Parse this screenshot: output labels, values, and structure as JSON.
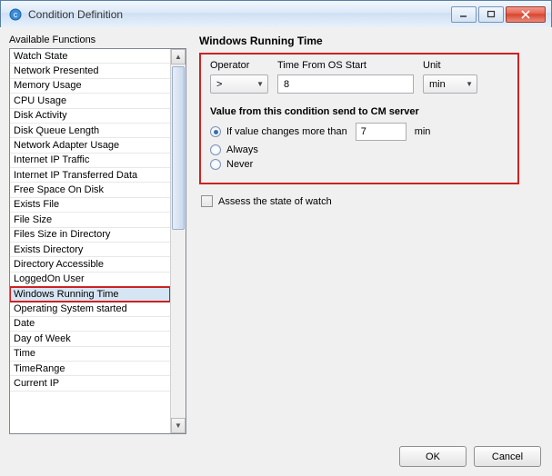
{
  "window": {
    "title": "Condition Definition"
  },
  "left": {
    "header": "Available Functions",
    "items": [
      "Watch State",
      "Network Presented",
      "Memory Usage",
      "CPU Usage",
      "Disk Activity",
      "Disk Queue Length",
      "Network Adapter Usage",
      "Internet IP Traffic",
      "Internet IP Transferred Data",
      "Free Space On Disk",
      "Exists File",
      "File Size",
      "Files Size in Directory",
      "Exists Directory",
      "Directory Accessible",
      "LoggedOn User",
      "Windows Running Time",
      "Operating System started",
      "Date",
      "Day of Week",
      "Time",
      "TimeRange",
      "Current IP"
    ],
    "selected_index": 16
  },
  "right": {
    "title": "Windows Running Time",
    "operator_label": "Operator",
    "operator_value": ">",
    "time_label": "Time From OS Start",
    "time_value": "8",
    "unit_label": "Unit",
    "unit_value": "min",
    "send_title": "Value from this condition send to CM server",
    "opt_changes_label": "If value changes more than",
    "opt_changes_value": "7",
    "opt_changes_unit": "min",
    "opt_always": "Always",
    "opt_never": "Never",
    "selected_send_option": "changes",
    "assess_label": "Assess the state of watch",
    "assess_checked": false
  },
  "footer": {
    "ok": "OK",
    "cancel": "Cancel"
  }
}
